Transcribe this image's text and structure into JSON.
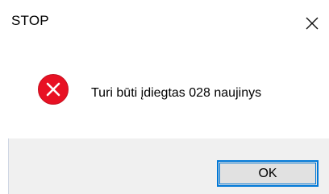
{
  "window": {
    "title": "STOP"
  },
  "dialog": {
    "icon": "error-icon",
    "message": "Turi būti įdiegtas 028 naujinys",
    "ok_label": "OK"
  },
  "colors": {
    "error_red": "#e81123",
    "footer_bg": "#f0f0f0",
    "button_border": "#0078d7",
    "button_bg": "#e1e1e1"
  }
}
